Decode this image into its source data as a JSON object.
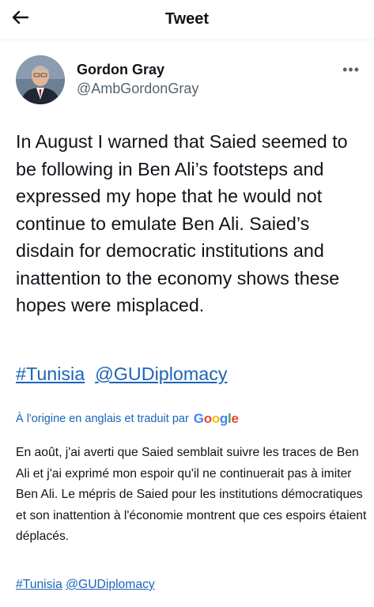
{
  "header": {
    "title": "Tweet",
    "back_icon": "arrow-left-icon"
  },
  "author": {
    "name": "Gordon Gray",
    "handle": "@AmbGordonGray",
    "more_icon": "more-dots-icon",
    "more_label": "•••"
  },
  "tweet": {
    "text": "In August I warned that Saied seemed to be following in Ben Ali’s footsteps and expressed my hope that he would not continue to emulate Ben Ali.  Saied’s disdain for democratic institutions and inattention to the economy shows these hopes were misplaced.",
    "hashtags": [
      "#Tunisia",
      "@GUDiplomacy"
    ]
  },
  "translation": {
    "label": "À l'origine en anglais et traduit par",
    "provider": "Google",
    "text": "En août, j'ai averti que Saied semblait suivre les traces de Ben Ali et j'ai exprimé mon espoir qu'il ne continuerait pas à imiter Ben Ali. Le mépris de Saied pour les institutions démocratiques et son inattention à l'économie montrent que ces espoirs étaient déplacés.",
    "hashtags": [
      "#Tunisia",
      "@GUDiplomacy"
    ]
  },
  "colors": {
    "link": "#1d64b8",
    "text": "#0f1419",
    "secondary": "#536471"
  }
}
